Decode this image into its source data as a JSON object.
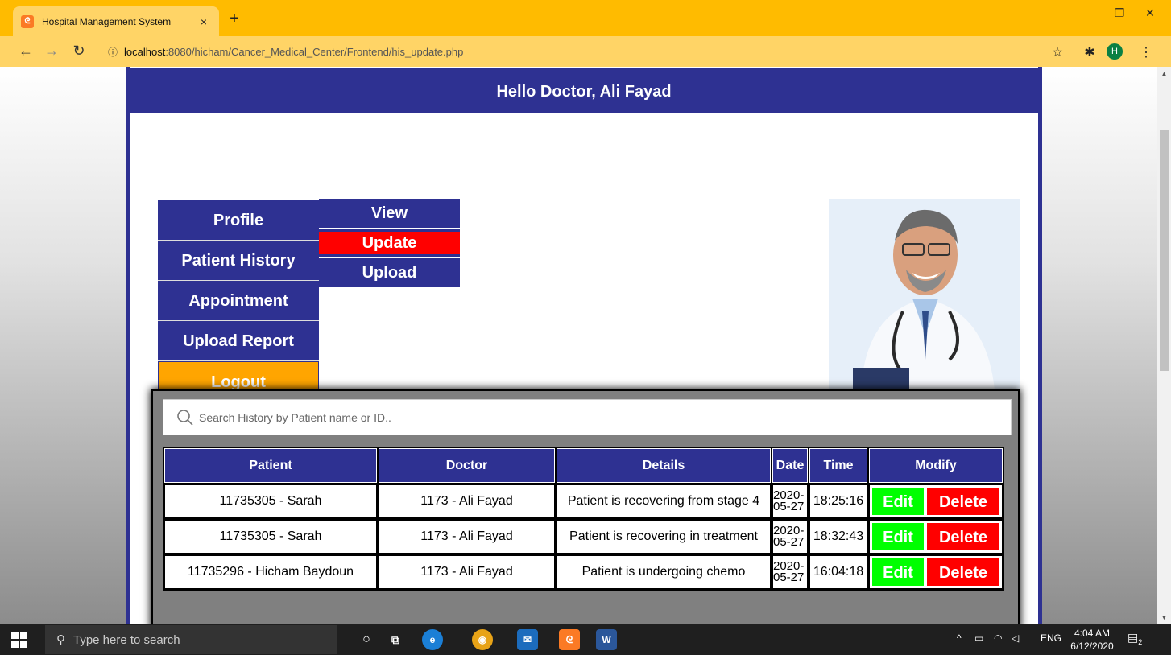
{
  "browser": {
    "tab_title": "Hospital Management System",
    "tab_favicon": "xampp-icon",
    "tab_close": "×",
    "new_tab": "+",
    "url_host": "localhost",
    "url_path": ":8080/hicham/Cancer_Medical_Center/Frontend/his_update.php",
    "profile_initial": "H",
    "minimize": "–",
    "restore": "❐",
    "close": "✕"
  },
  "page": {
    "greeting": "Hello Doctor, Ali Fayad",
    "menu": [
      {
        "label": "Profile"
      },
      {
        "label": "Patient History"
      },
      {
        "label": "Appointment"
      },
      {
        "label": "Upload Report"
      },
      {
        "label": "Logout"
      }
    ],
    "submenu": [
      {
        "label": "View"
      },
      {
        "label": "Update"
      },
      {
        "label": "Upload"
      }
    ],
    "search_placeholder": "Search History by Patient name or ID..",
    "table": {
      "headers": [
        "Patient",
        "Doctor",
        "Details",
        "Date",
        "Time",
        "Modify"
      ],
      "rows": [
        {
          "patient": "11735305 - Sarah",
          "doctor": "1173 - Ali Fayad",
          "details": "Patient is recovering from stage 4",
          "date": "2020-05-27",
          "time": "18:25:16"
        },
        {
          "patient": "11735305 - Sarah",
          "doctor": "1173 - Ali Fayad",
          "details": "Patient is recovering in treatment",
          "date": "2020-05-27",
          "time": "18:32:43"
        },
        {
          "patient": "11735296 - Hicham Baydoun",
          "doctor": "1173 - Ali Fayad",
          "details": "Patient is undergoing chemo",
          "date": "2020-05-27",
          "time": "16:04:18"
        }
      ],
      "edit_label": "Edit",
      "delete_label": "Delete"
    },
    "colors": {
      "primary": "#2e3192",
      "active": "#ff0000",
      "logout": "#ffa500",
      "edit": "#00ff00",
      "delete": "#ff0000"
    }
  },
  "taskbar": {
    "search_placeholder": "Type here to search",
    "tray_lang": "ENG",
    "time": "4:04 AM",
    "date": "6/12/2020",
    "notification_count": "2"
  }
}
